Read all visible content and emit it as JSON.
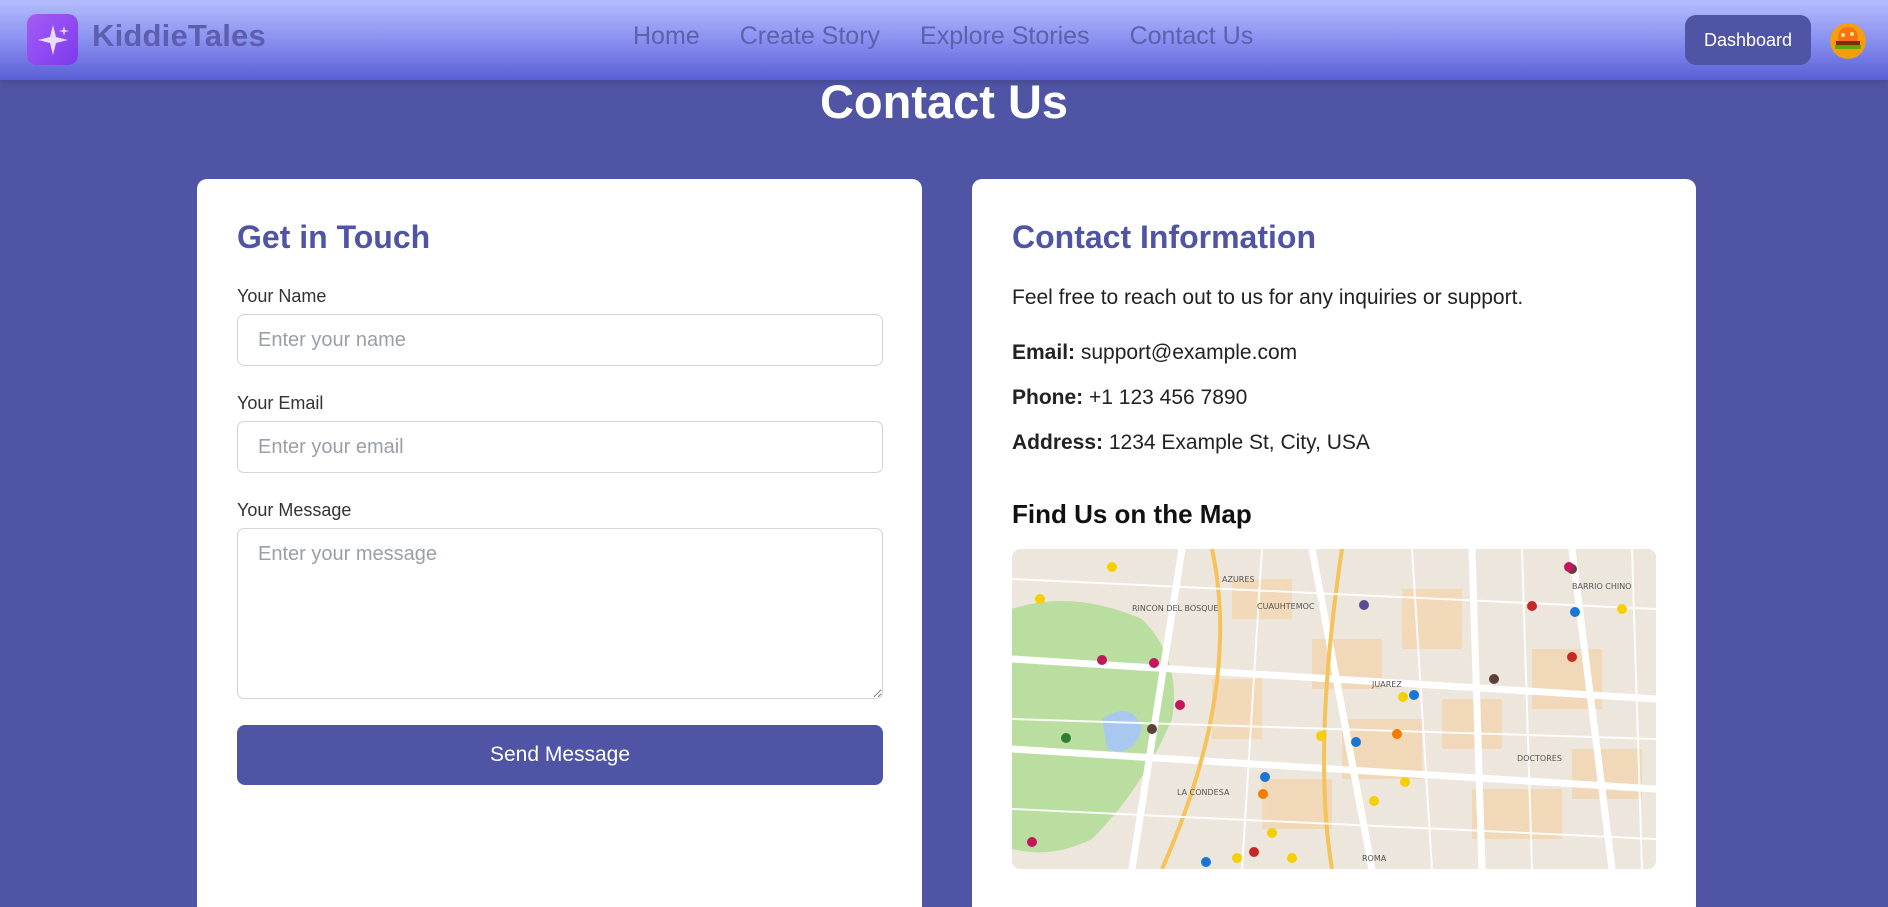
{
  "navbar": {
    "brand": "KiddieTales",
    "links": [
      "Home",
      "Create Story",
      "Explore Stories",
      "Contact Us"
    ],
    "dashboard_label": "Dashboard"
  },
  "page": {
    "title": "Contact Us"
  },
  "form": {
    "heading": "Get in Touch",
    "name_label": "Your Name",
    "name_placeholder": "Enter your name",
    "email_label": "Your Email",
    "email_placeholder": "Enter your email",
    "message_label": "Your Message",
    "message_placeholder": "Enter your message",
    "send_label": "Send Message"
  },
  "info": {
    "heading": "Contact Information",
    "intro": "Feel free to reach out to us for any inquiries or support.",
    "email_label": "Email:",
    "email_value": "support@example.com",
    "phone_label": "Phone:",
    "phone_value": "+1 123 456 7890",
    "address_label": "Address:",
    "address_value": "1234 Example St, City, USA",
    "map_heading": "Find Us on the Map",
    "map_labels": [
      "RINCON DEL BOSQUE",
      "CUAUHTEMOC",
      "JUAREZ",
      "LA CONDESA",
      "DOCTORES",
      "BARRIO CHINO",
      "AZURES",
      "ROMA"
    ]
  }
}
